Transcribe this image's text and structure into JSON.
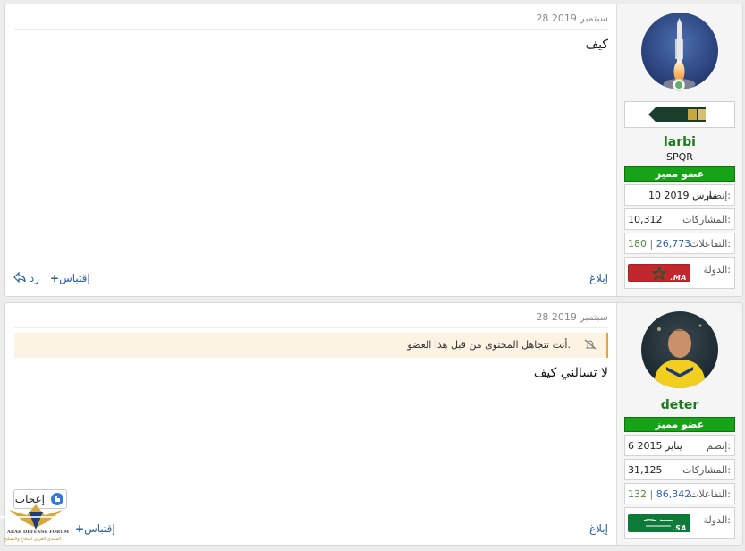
{
  "posts": [
    {
      "date": "28 سبتمبر 2019",
      "body": "كيف",
      "user": {
        "name": "larbi",
        "title": "SPQR",
        "badge": "عضو مميز",
        "joined_label": "إنضم:",
        "joined_value": "10 مارس 2019",
        "posts_label": "المشاركات:",
        "posts_value": "10,312",
        "reactions_label": "التفاعلات:",
        "reactions_main": "26,773",
        "reactions_sep": " | ",
        "reactions_other": "180",
        "country_label": "الدولة:",
        "flag_code": ".MA",
        "online": true
      },
      "actions": {
        "report": "إبلاغ",
        "quote": "إقتباس",
        "reply": "رد"
      }
    },
    {
      "date": "28 سبتمبر 2019",
      "ignored_notice": "أنت تتجاهل المحتوى من قبل هذا العضو.",
      "body": "لا تسالني كيف",
      "user": {
        "name": "deter",
        "badge": "عضو مميز",
        "joined_label": "إنضم:",
        "joined_value": "6 يناير 2015",
        "posts_label": "المشاركات:",
        "posts_value": "31,125",
        "reactions_label": "التفاعلات:",
        "reactions_main": "86,342",
        "reactions_sep": " | ",
        "reactions_other": "132",
        "country_label": "الدولة:",
        "flag_code": ".SA"
      },
      "like_label": "إعجاب",
      "actions": {
        "report": "إبلاغ",
        "quote": "إقتباس"
      }
    }
  ],
  "watermark": {
    "line1": "ARAB DEFENSE FORUM",
    "line2": "المنتدى العربي للدفاع والتسليح"
  },
  "colors": {
    "username": "#1d7a1d",
    "badge": "#17a317",
    "link": "#2a5f9e",
    "online": "#63b06a",
    "notice_border": "#e8a43c"
  },
  "icons": [
    "shortcut-reply-icon",
    "plus-icon",
    "ignore-bell-icon",
    "thumbs-up-icon",
    "online-icon"
  ]
}
